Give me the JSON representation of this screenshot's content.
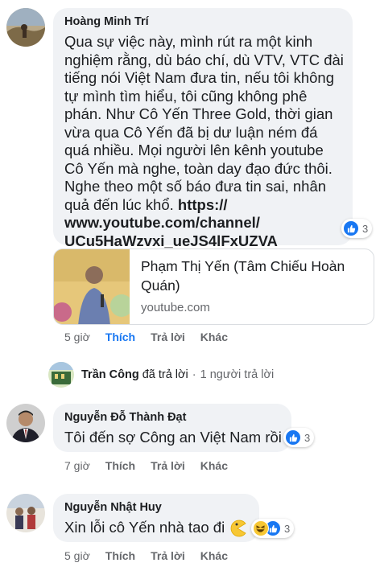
{
  "comments": [
    {
      "author": "Hoàng Minh Trí",
      "text": "Qua sự việc này, mình rút ra một kinh nghiệm rằng, dù báo chí, dù VTV, VTC đài tiếng nói Việt Nam đưa tin, nếu tôi không tự mình tìm hiểu, tôi cũng không phê phán. Như Cô Yến Three Gold, thời gian vừa qua Cô Yến đã bị dư luận ném đá quá nhiều. Mọi người lên kênh youtube Cô Yến mà nghe, toàn day đạo đức thôi. Nghe theo một số báo đưa tin sai, nhân quả đến lúc khổ.",
      "link_line1": "https://",
      "link_line2": "www.youtube.com/channel/",
      "link_line3": "UCu5HaWzvxi_ueJS4lFxUZVA",
      "reaction_count": "3",
      "time": "5 giờ",
      "like": "Thích",
      "reply": "Trả lời",
      "more": "Khác"
    },
    {
      "author": "Nguyễn Đỗ Thành Đạt",
      "text": "Tôi đến sợ Công an Việt Nam rồi",
      "reaction_count": "3",
      "time": "7 giờ",
      "like": "Thích",
      "reply": "Trả lời",
      "more": "Khác"
    },
    {
      "author": "Nguyễn Nhật Huy",
      "text": "Xin lỗi cô Yến nhà tao đi",
      "reaction_count": "3",
      "time": "5 giờ",
      "like": "Thích",
      "reply": "Trả lời",
      "more": "Khác"
    }
  ],
  "link_preview": {
    "title": "Phạm Thị Yến (Tâm Chiếu Hoàn Quán)",
    "domain": "youtube.com"
  },
  "reply_summary": {
    "name": "Trần Công",
    "verb": "đã trả lời",
    "separator": "·",
    "count_text": "1 người trả lời"
  },
  "icons": {
    "like": "like-thumb-icon",
    "laugh": "haha-emoji-icon",
    "yum": "pacman-emoji-icon"
  },
  "colors": {
    "facebook_blue": "#1877f2",
    "bubble_bg": "#f0f2f5",
    "meta_gray": "#65676b"
  }
}
